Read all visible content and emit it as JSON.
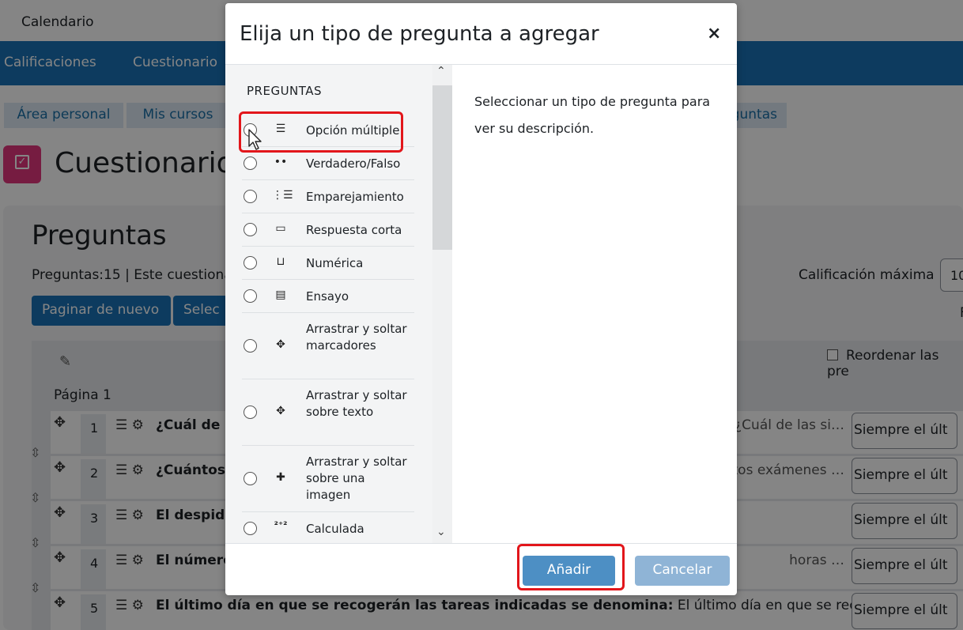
{
  "page": {
    "top_link": "Calendario",
    "nav": [
      "Calificaciones",
      "Cuestionario"
    ],
    "breadcrumbs": [
      "Área personal",
      "Mis cursos",
      "guntas"
    ],
    "title": "Cuestionario",
    "section_title": "Preguntas",
    "summary": "Preguntas:15 | Este cuestionar",
    "grade_label": "Calificación máxima",
    "grade_value": "10",
    "right_edge_text": "F",
    "btn_repaginate": "Paginar de nuevo",
    "btn_select": "Selec",
    "reorder_label": "Reordenar las pre",
    "page_label": "Página 1",
    "questions": [
      {
        "num": "1",
        "text": "¿Cuál de l",
        "tail": ": ¿Cuál de las si…",
        "select": "Siempre el últ"
      },
      {
        "num": "2",
        "text": "¿Cuántos",
        "tail": "ntos exámenes …",
        "select": "Siempre el últ"
      },
      {
        "num": "3",
        "text": "El despido",
        "tail": "",
        "select": "Siempre el últ"
      },
      {
        "num": "4",
        "text": "El número",
        "tail": "horas …",
        "select": "Siempre el últ"
      },
      {
        "num": "5",
        "text": "El último día en que se recogerán las tareas indicadas se denomina:",
        "tail": " El último día en que se recog…",
        "select": "Siempre el últ"
      }
    ]
  },
  "modal": {
    "title": "Elija un tipo de pregunta a agregar",
    "close": "×",
    "category": "PREGUNTAS",
    "description": "Seleccionar un tipo de pregunta para ver su descripción.",
    "types": [
      {
        "label": "Opción múltiple",
        "icon": "list-icon"
      },
      {
        "label": "Verdadero/Falso",
        "icon": "dots-icon"
      },
      {
        "label": "Emparejamiento",
        "icon": "matching-icon"
      },
      {
        "label": "Respuesta corta",
        "icon": "short-answer-icon"
      },
      {
        "label": "Numérica",
        "icon": "numeric-icon"
      },
      {
        "label": "Ensayo",
        "icon": "essay-icon"
      },
      {
        "label": "Arrastrar y soltar marcadores",
        "icon": "drag-markers-icon"
      },
      {
        "label": "Arrastrar y soltar sobre texto",
        "icon": "drag-text-icon"
      },
      {
        "label": "Arrastrar y soltar sobre una imagen",
        "icon": "drag-image-icon"
      },
      {
        "label": "Calculada",
        "icon": "calculated-icon"
      }
    ],
    "add_button": "Añadir",
    "cancel_button": "Cancelar",
    "highlight_color": "#e2161b"
  }
}
